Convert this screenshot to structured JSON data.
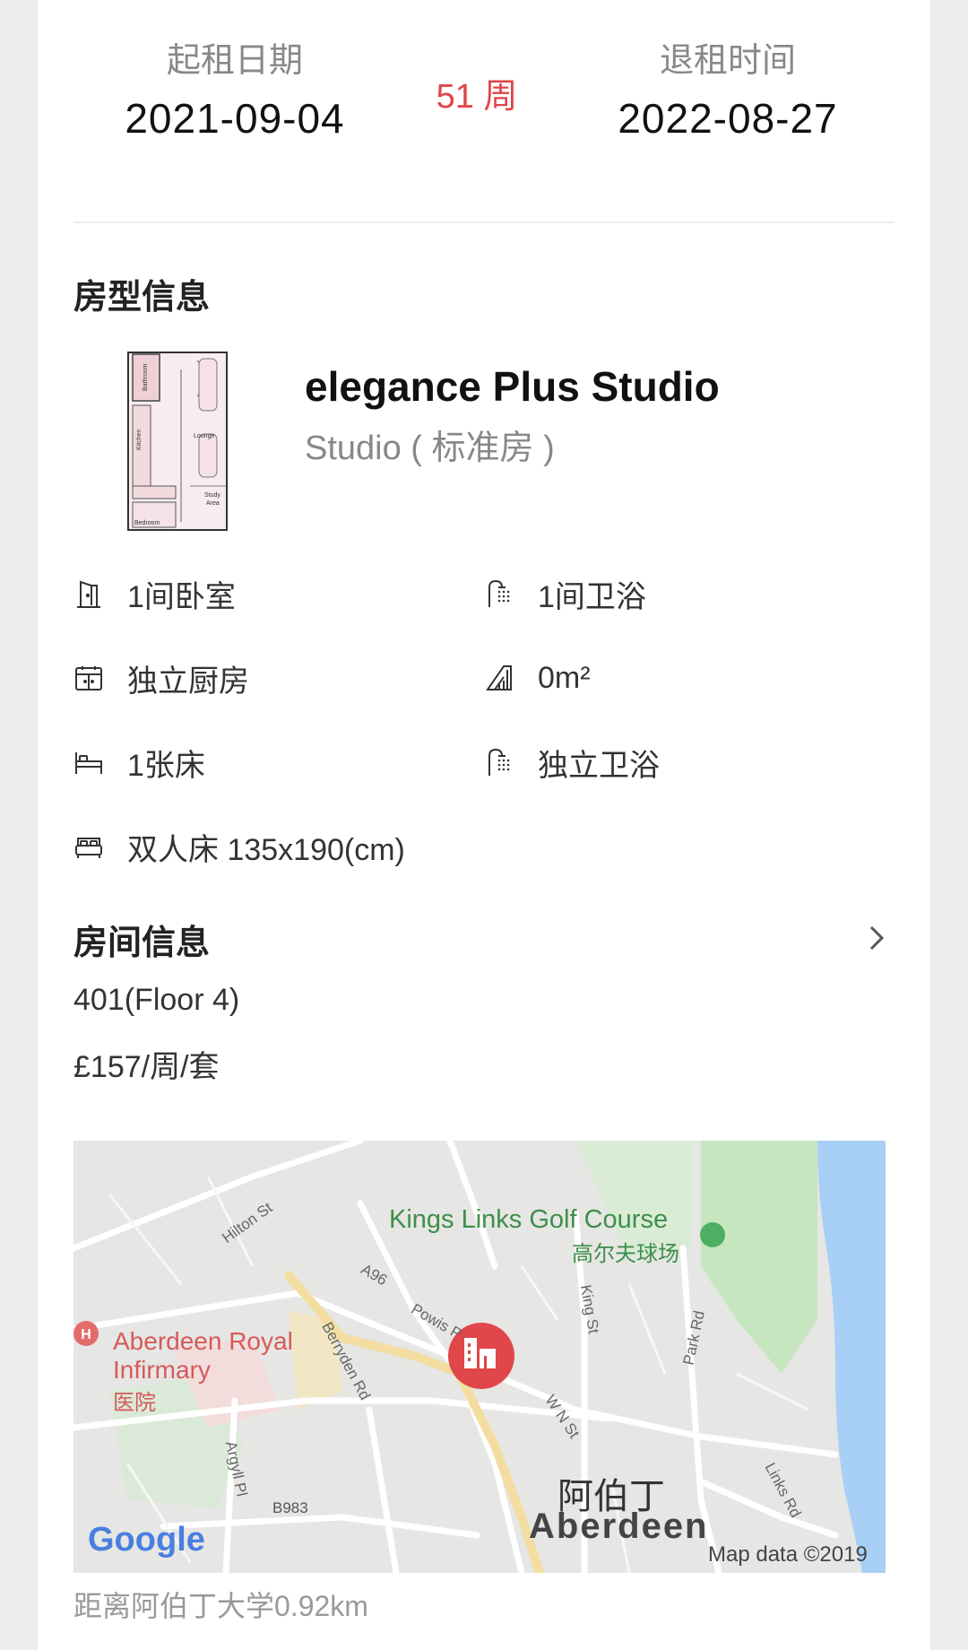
{
  "lease": {
    "start_label": "起租日期",
    "start_date": "2021-09-04",
    "duration": "51 周",
    "end_label": "退租时间",
    "end_date": "2022-08-27"
  },
  "room_type": {
    "section_title": "房型信息",
    "name": "elegance Plus Studio",
    "subtitle": "Studio ( 标准房 )",
    "floorplan_labels": {
      "bathroom": "Bathroom",
      "kitchen": "Kitchen",
      "lounge": "Lounge",
      "study": "Study",
      "area": "Area",
      "bedroom": "Bedroom"
    },
    "features": [
      {
        "icon": "door-icon",
        "text": "1间卧室"
      },
      {
        "icon": "shower-icon",
        "text": "1间卫浴"
      },
      {
        "icon": "kitchen-icon",
        "text": "独立厨房"
      },
      {
        "icon": "area-icon",
        "text": "0m²"
      },
      {
        "icon": "bed-icon",
        "text": "1张床"
      },
      {
        "icon": "shower-icon",
        "text": "独立卫浴"
      },
      {
        "icon": "double-bed-icon",
        "text": "双人床 135x190(cm)"
      }
    ]
  },
  "room_info": {
    "section_title": "房间信息",
    "room_number": "401(Floor 4)",
    "price": "£157/周/套"
  },
  "map": {
    "labels": {
      "hilton_st": "Hilton St",
      "golf_en": "Kings Links Golf Course",
      "golf_cn": "高尔夫球场",
      "a96": "A96",
      "king_st": "King St",
      "powis": "Powis P",
      "berryden": "Berryden Rd",
      "park_rd": "Park Rd",
      "infirmary_1": "Aberdeen Royal",
      "infirmary_2": "Infirmary",
      "infirmary_cn": "医院",
      "wn_st": "W N St",
      "argyll": "Argyll Pl",
      "b983": "B983",
      "city_cn": "阿伯丁",
      "city_en": "Aberdeen",
      "links_rd": "Links Rd",
      "google": "Google",
      "map_data": "Map data ©2019"
    },
    "colors": {
      "water": "#a8cff5",
      "park": "#c6e6c0",
      "road": "#ffffff",
      "highlight_road": "#f3dda0",
      "pin": "#e0464a"
    }
  },
  "distance": "距离阿伯丁大学0.92km"
}
